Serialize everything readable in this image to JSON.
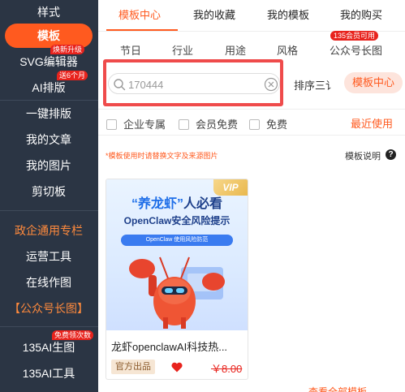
{
  "sidebar": {
    "items": [
      {
        "label": "样式"
      },
      {
        "label": "模板"
      },
      {
        "label": "SVG编辑器"
      },
      {
        "label": "AI排版"
      },
      {
        "label": "一键排版"
      },
      {
        "label": "我的文章"
      },
      {
        "label": "我的图片"
      },
      {
        "label": "剪切板"
      },
      {
        "label": "政企通用专栏"
      },
      {
        "label": "运营工具"
      },
      {
        "label": "在线作图"
      },
      {
        "label": "【公众号长图】"
      },
      {
        "label": "135AI生图"
      },
      {
        "label": "135AI工具"
      }
    ],
    "badges": {
      "svg": "焕新升级",
      "ai": "送6个月",
      "ai_image": "免费领次数"
    }
  },
  "tabs": [
    {
      "label": "模板中心"
    },
    {
      "label": "我的收藏"
    },
    {
      "label": "我的模板"
    },
    {
      "label": "我的购买"
    }
  ],
  "categories": [
    {
      "label": "节日"
    },
    {
      "label": "行业"
    },
    {
      "label": "用途"
    },
    {
      "label": "风格"
    },
    {
      "label": "公众号长图"
    }
  ],
  "category_badge": "135会员可用",
  "search": {
    "value": "170444",
    "placeholder": "170444"
  },
  "sort_label": "排序三讠",
  "template_center_button": "模板中心",
  "filters": [
    {
      "label": "企业专属"
    },
    {
      "label": "会员免费"
    },
    {
      "label": "免费"
    }
  ],
  "recent_label": "最近使用",
  "notice": "*模板使用时请替换文字及来源图片",
  "template_desc": "模板说明",
  "help_icon": "?",
  "card": {
    "vip": "VIP",
    "thumb_title_prefix": "“养龙虾”",
    "thumb_title_suffix": "人必看",
    "thumb_subtitle": "OpenClaw安全风险提示",
    "thumb_pill": "OpenClaw 使用风险防范",
    "title": "龙虾openclawAI科技热...",
    "tag": "官方出品",
    "price": "￥8.00"
  },
  "bottom_peek": "查看全部模板"
}
